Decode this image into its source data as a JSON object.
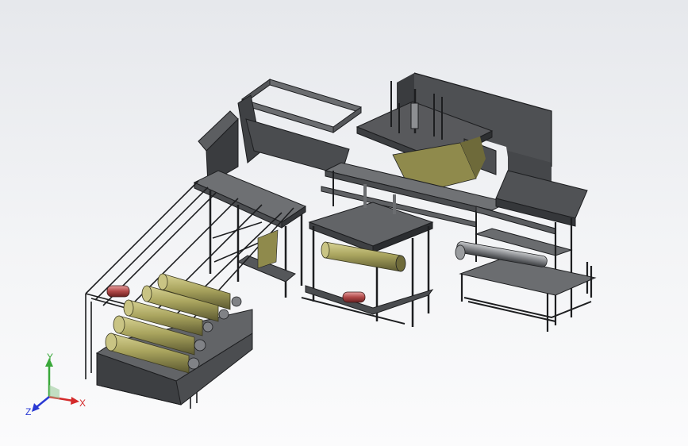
{
  "triad": {
    "x_label": "X",
    "y_label": "Y",
    "z_label": "Z",
    "x_color": "#d42a2a",
    "y_color": "#3aa83a",
    "z_color": "#2a3ad4"
  },
  "colors": {
    "frame": "#2b2d30",
    "sheet": "#5a5c5f",
    "film": "#9a9550",
    "roller": "#b0ab6a",
    "accent_red": "#b04848",
    "background_top": "#e6e8ec",
    "background_bottom": "#fbfbfc"
  }
}
